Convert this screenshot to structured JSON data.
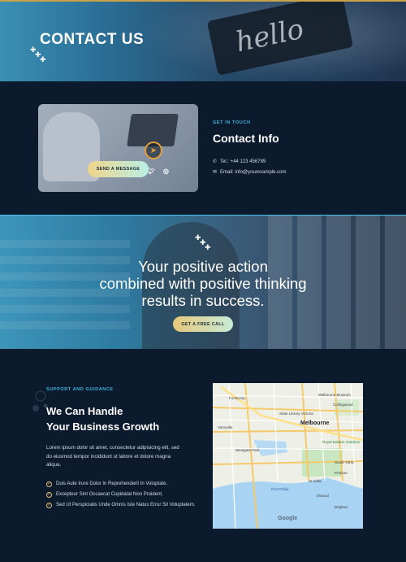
{
  "hero": {
    "title": "CONTACT US"
  },
  "contact_info": {
    "eyebrow": "GET IN TOUCH",
    "title": "Contact Info",
    "phone": "Tel.: +44 123 456789",
    "email": "Email: info@yourexample.com",
    "send_button": "SEND A MESSAGE",
    "socials": [
      "f",
      "t",
      "ig"
    ]
  },
  "quote": {
    "lines": [
      "Your positive action",
      "combined with positive thinking",
      "results in success."
    ],
    "button": "GET A FREE CALL"
  },
  "support": {
    "eyebrow": "SUPPORT AND GUIDANCE",
    "title_lines": [
      "We Can Handle",
      "Your Business Growth"
    ],
    "body": "Lorem ipsum dolor sit amet, consectetur adipisicing elit, sed do eiusmod tempor incididunt ut labore et dolore magna aliqua.",
    "list": [
      "Duis Aute Irure Dolor In Reprehenderit In Voluptate.",
      "Excepteur Sint Occaecat Cupidatat Non Proident.",
      "Sed Ut Perspiciatis Unde Omnis Iste Natus Error Sit Voluptatem."
    ]
  },
  "map": {
    "labels": [
      "Footscray",
      "Melbourne Museum",
      "Collingwood",
      "Yarraville",
      "State Library Victoria",
      "Melbourne",
      "Royal Botanic Gardens",
      "Westgate Park",
      "South Yarra",
      "Port Phillip",
      "St Kilda",
      "Prahran",
      "Elwood",
      "Brighton"
    ],
    "attribution": "Google"
  },
  "colors": {
    "accent": "#3fb6e0",
    "gold": "#e8c77a",
    "background": "#0c1a2e"
  }
}
